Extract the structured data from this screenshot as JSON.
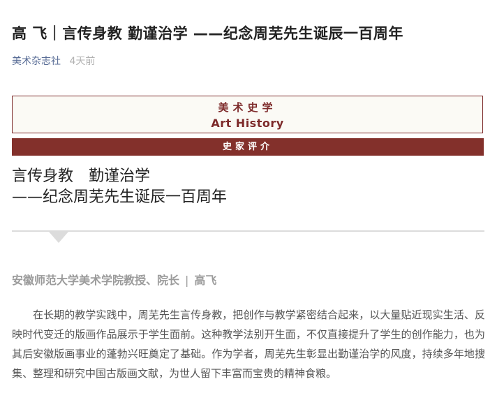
{
  "article": {
    "title": "高 飞｜言传身教 勤谨治学 ——纪念周芜先生诞辰一百周年",
    "source": "美术杂志社",
    "time": "4天前"
  },
  "banner": {
    "cn": "美术史学",
    "en": "Art History",
    "bar": "史家评介"
  },
  "heading": {
    "line1": "言传身教　勤谨治学",
    "line2": "——纪念周芜先生诞辰一百周年"
  },
  "author": {
    "affiliation": "安徽师范大学美术学院教授、院长",
    "separator": "|",
    "name": "高飞"
  },
  "body": {
    "paragraph": "在长期的教学实践中，周芜先生言传身教，把创作与教学紧密结合起来，以大量贴近现实生活、反映时代变迁的版画作品展示于学生面前。这种教学法别开生面，不仅直接提升了学生的创作能力，也为其后安徽版画事业的蓬勃兴旺奠定了基础。作为学者，周芜先生彰显出勤谨治学的风度，持续多年地搜集、整理和研究中国古版画文献，为世人留下丰富而宝贵的精神食粮。"
  },
  "colors": {
    "accent": "#83302b",
    "link": "#576b95"
  }
}
